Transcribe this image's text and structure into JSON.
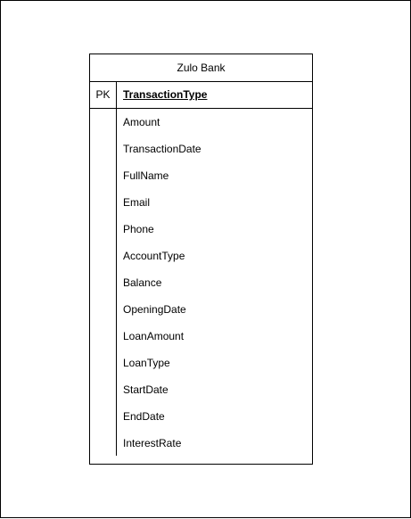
{
  "entity": {
    "title": "Zulo Bank",
    "primary_key": {
      "key_label": "PK",
      "field": "TransactionType"
    },
    "fields": [
      "Amount",
      "TransactionDate",
      "FullName",
      "Email",
      "Phone",
      "AccountType",
      "Balance",
      "OpeningDate",
      "LoanAmount",
      "LoanType",
      "StartDate",
      "EndDate",
      "InterestRate"
    ]
  }
}
